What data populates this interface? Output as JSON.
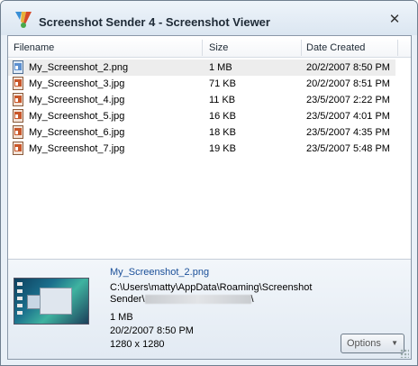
{
  "window": {
    "title": "Screenshot Sender 4 - Screenshot Viewer",
    "close_symbol": "✕"
  },
  "list": {
    "columns": [
      "Filename",
      "Size",
      "Date Created"
    ],
    "rows": [
      {
        "filename": "My_Screenshot_2.png",
        "size": "1 MB",
        "date": "20/2/2007 8:50 PM",
        "icon": "png-file-icon",
        "selected": true
      },
      {
        "filename": "My_Screenshot_3.jpg",
        "size": "71 KB",
        "date": "20/2/2007 8:51 PM",
        "icon": "jpg-file-icon",
        "selected": false
      },
      {
        "filename": "My_Screenshot_4.jpg",
        "size": "11 KB",
        "date": "23/5/2007 2:22 PM",
        "icon": "jpg-file-icon",
        "selected": false
      },
      {
        "filename": "My_Screenshot_5.jpg",
        "size": "16 KB",
        "date": "23/5/2007 4:01 PM",
        "icon": "jpg-file-icon",
        "selected": false
      },
      {
        "filename": "My_Screenshot_6.jpg",
        "size": "18 KB",
        "date": "23/5/2007 4:35 PM",
        "icon": "jpg-file-icon",
        "selected": false
      },
      {
        "filename": "My_Screenshot_7.jpg",
        "size": "19 KB",
        "date": "23/5/2007 5:48 PM",
        "icon": "jpg-file-icon",
        "selected": false
      }
    ]
  },
  "preview": {
    "filename_link": "My_Screenshot_2.png",
    "path_line1": "C:\\Users\\matty\\AppData\\Roaming\\Screenshot",
    "path_line2_prefix": "Sender\\",
    "path_line2_suffix": "\\",
    "size": "1 MB",
    "date": "20/2/2007 8:50 PM",
    "dimensions": "1280 x 1280",
    "options_label": "Options",
    "options_arrow": "▼"
  },
  "colors": {
    "link": "#1a4f99",
    "selected_row": "#ededed",
    "window_border": "#6f7f8f"
  }
}
